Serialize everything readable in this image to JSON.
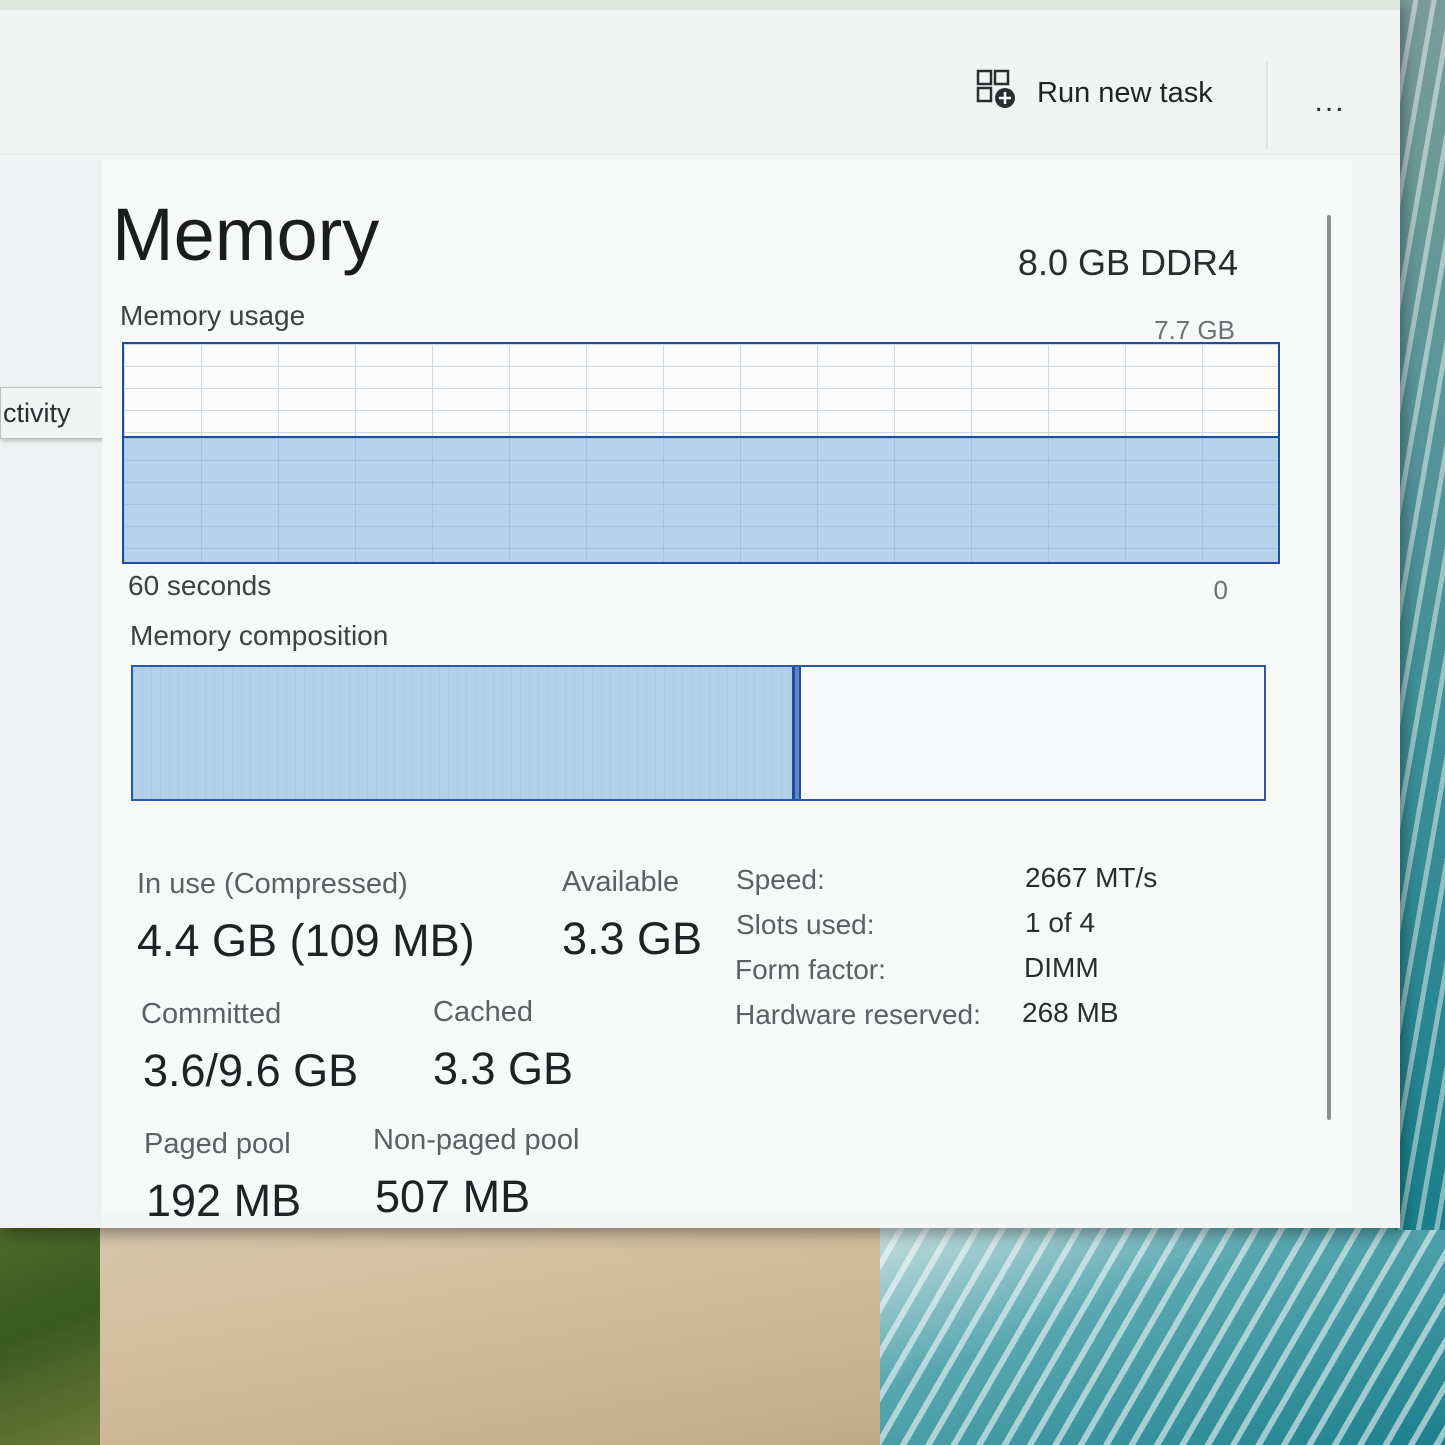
{
  "toolbar": {
    "run_new_task_label": "Run new task",
    "more_label": "..."
  },
  "nav": {
    "tooltip_text": "ctivity"
  },
  "memory": {
    "title": "Memory",
    "spec": "8.0 GB DDR4",
    "usage_label": "Memory usage",
    "usage_max": "7.7 GB",
    "usage_time_label": "60 seconds",
    "usage_min": "0",
    "usage_fraction": 0.58,
    "composition_label": "Memory composition",
    "composition_in_use_fraction": 0.585,
    "composition_modified_fraction": 0.006
  },
  "stats": {
    "in_use_label": "In use (Compressed)",
    "in_use_value": "4.4 GB (109 MB)",
    "available_label": "Available",
    "available_value": "3.3 GB",
    "committed_label": "Committed",
    "committed_value": "3.6/9.6 GB",
    "cached_label": "Cached",
    "cached_value": "3.3 GB",
    "paged_pool_label": "Paged pool",
    "paged_pool_value": "192 MB",
    "non_paged_pool_label": "Non-paged pool",
    "non_paged_pool_value": "507 MB"
  },
  "specs": {
    "speed_label": "Speed:",
    "speed_value": "2667 MT/s",
    "slots_label": "Slots used:",
    "slots_value": "1 of 4",
    "form_factor_label": "Form factor:",
    "form_factor_value": "DIMM",
    "hw_reserved_label": "Hardware reserved:",
    "hw_reserved_value": "268 MB"
  },
  "colors": {
    "graph_border": "#1e4f9a",
    "graph_fill": "#b7d3eb"
  },
  "icons": {
    "run_task": "run-new-task-icon",
    "more": "more-options-icon"
  }
}
